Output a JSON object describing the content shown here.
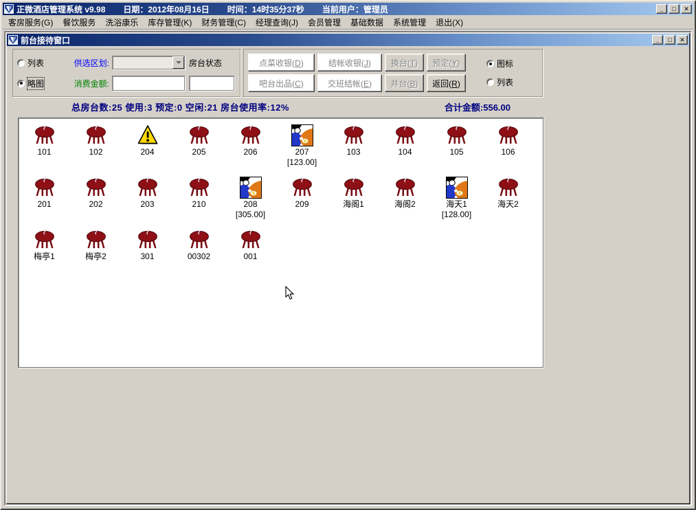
{
  "window": {
    "app_title": "正微酒店管理系统  v9.98",
    "date_label": "日期：2012年08月16日",
    "time_label": "时间：14时35分37秒",
    "user_label": "当前用户：管理员",
    "icons": {
      "minimize": "_",
      "maximize": "□",
      "close": "✕"
    }
  },
  "menu": {
    "items": [
      {
        "label": "客房服务(G)"
      },
      {
        "label": "餐饮服务"
      },
      {
        "label": "洗浴康乐"
      },
      {
        "label": "库存管理(K)"
      },
      {
        "label": "财务管理(C)"
      },
      {
        "label": "经理查询(J)"
      },
      {
        "label": "会员管理"
      },
      {
        "label": "基础数据"
      },
      {
        "label": "系统管理"
      },
      {
        "label": "退出(X)"
      }
    ]
  },
  "child_window": {
    "title": "前台接待窗口"
  },
  "filters": {
    "list_radio_label": "列表",
    "thumb_radio_label": "略图",
    "selected_view": "略图",
    "area_label": "供选区划:",
    "area_value": "",
    "table_status_label": "房台状态",
    "amount_label": "消费金额:",
    "amount_value": "",
    "table_status_value": ""
  },
  "toolbar": {
    "buttons": [
      {
        "label": "点菜收银(D)",
        "face": "white",
        "enabled": false
      },
      {
        "label": "结帐收银(J)",
        "face": "white",
        "enabled": false
      },
      {
        "label": "换台(T)",
        "face": "gray",
        "enabled": false
      },
      {
        "label": "预定(Y)",
        "face": "gray",
        "enabled": false
      },
      {
        "label": "吧台出品(C)",
        "face": "white",
        "enabled": false
      },
      {
        "label": "交班结帐(E)",
        "face": "white",
        "enabled": false
      },
      {
        "label": "并台(B)",
        "face": "gray",
        "enabled": false
      },
      {
        "label": "返回(R)",
        "face": "gray",
        "enabled": true
      }
    ],
    "view_icon_label": "图标",
    "view_list_label": "列表",
    "selected_view_mode": "图标"
  },
  "status": {
    "summary_text": "总房台数:25 使用:3 预定:0 空闲:21  房台使用率:12%",
    "total_amount_text": "合计金额:556.00",
    "total_tables": 25,
    "in_use": 3,
    "reserved": 0,
    "vacant": 21,
    "usage_rate_percent": 12,
    "total_amount": 556.0
  },
  "tables": {
    "icon_legend": {
      "empty": "round-table-icon",
      "warning": "warning-triangle-icon",
      "occupied": "occupied-table-icon"
    },
    "items": [
      {
        "label": "101",
        "state": "empty"
      },
      {
        "label": "102",
        "state": "empty"
      },
      {
        "label": "204",
        "state": "warning"
      },
      {
        "label": "205",
        "state": "empty"
      },
      {
        "label": "206",
        "state": "empty"
      },
      {
        "label": "207",
        "state": "occupied",
        "amount": "[123.00]"
      },
      {
        "label": "103",
        "state": "empty"
      },
      {
        "label": "104",
        "state": "empty"
      },
      {
        "label": "105",
        "state": "empty"
      },
      {
        "label": "106",
        "state": "empty"
      },
      {
        "label": "201",
        "state": "empty"
      },
      {
        "label": "202",
        "state": "empty"
      },
      {
        "label": "203",
        "state": "empty"
      },
      {
        "label": "210",
        "state": "empty"
      },
      {
        "label": "208",
        "state": "occupied",
        "amount": "[305.00]"
      },
      {
        "label": "209",
        "state": "empty"
      },
      {
        "label": "海阁1",
        "state": "empty"
      },
      {
        "label": "海阁2",
        "state": "empty"
      },
      {
        "label": "海天1",
        "state": "occupied",
        "amount": "[128.00]"
      },
      {
        "label": "海天2",
        "state": "empty"
      },
      {
        "label": "梅亭1",
        "state": "empty"
      },
      {
        "label": "梅亭2",
        "state": "empty"
      },
      {
        "label": "301",
        "state": "empty"
      },
      {
        "label": "00302",
        "state": "empty"
      },
      {
        "label": "001",
        "state": "empty"
      }
    ]
  },
  "colors": {
    "titlebar_gradient_start": "#0a246a",
    "titlebar_gradient_end": "#a6caf0",
    "face": "#D4D0C8",
    "status_text": "#000080",
    "area_label": "#0000FF",
    "amount_label": "#008000",
    "table_maroon": "#8e1016",
    "warning_yellow": "#FFD800",
    "occupied_orange": "#E07818"
  }
}
